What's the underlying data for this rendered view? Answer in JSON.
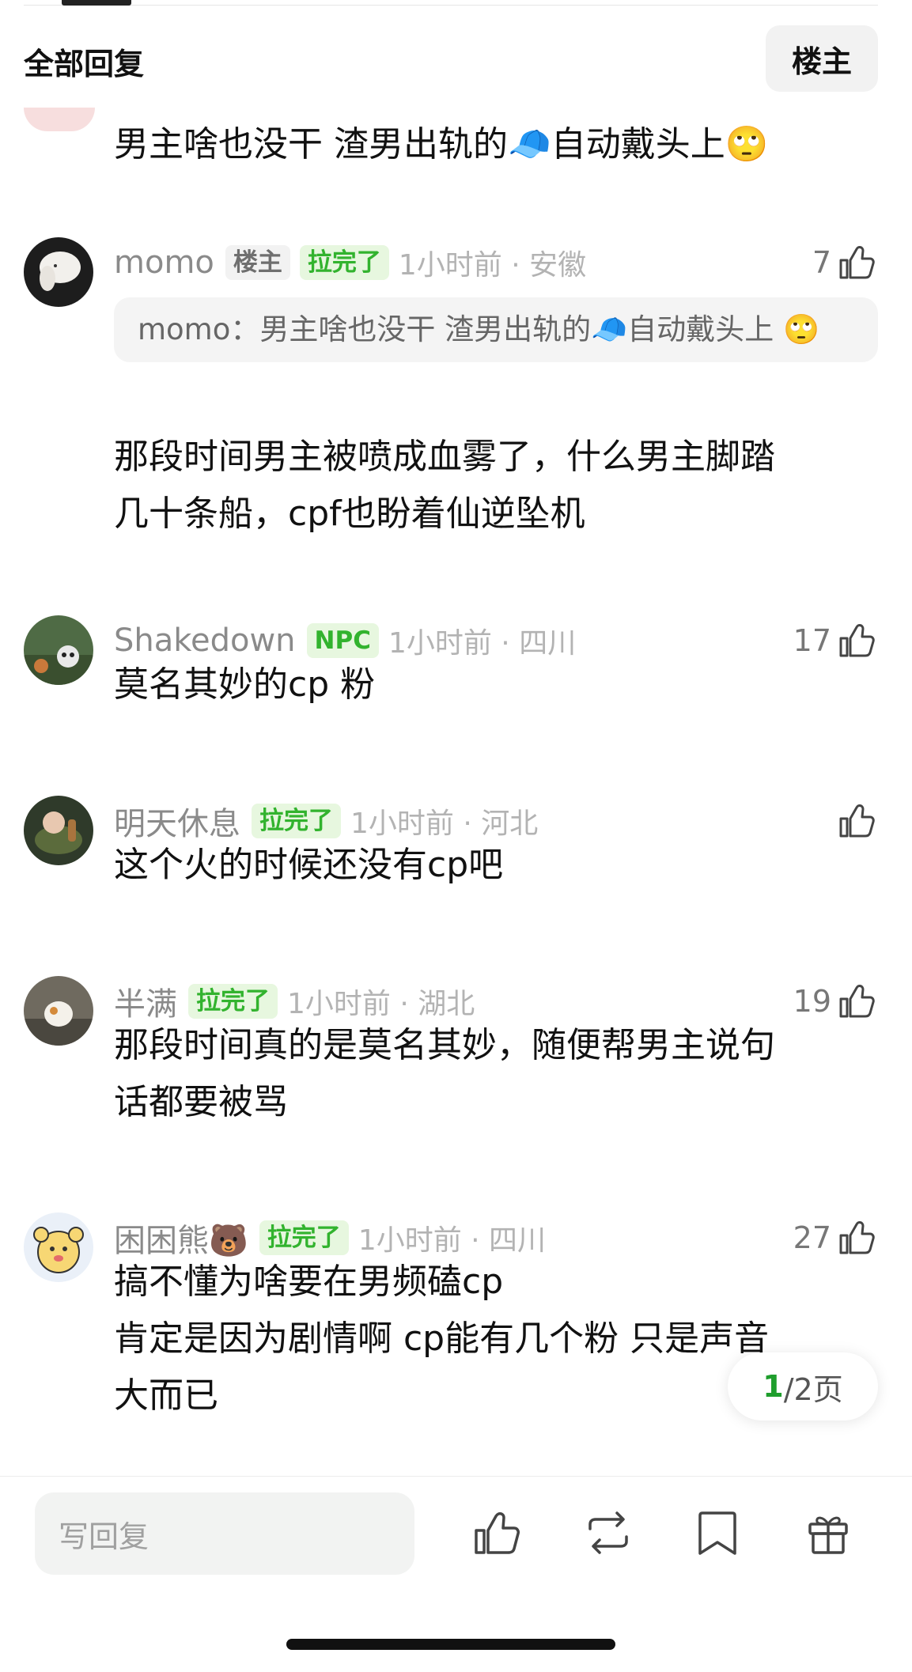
{
  "header": {
    "title": "全部回复",
    "op_button": "楼主"
  },
  "partial_comment": {
    "text": "男主啥也没干 渣男出轨的🧢自动戴头上🙄"
  },
  "comments": [
    {
      "username": "momo",
      "tags": [
        {
          "label": "楼主",
          "style": "gray"
        },
        {
          "label": "拉完了",
          "style": "green"
        }
      ],
      "time_location": "1小时前 · 安徽",
      "likes": "7",
      "quote": {
        "author": "momo：",
        "text": "男主啥也没干 渣男出轨的🧢自动戴头上 🙄"
      },
      "lines": [
        "那段时间男主被喷成血雾了，什么男主脚踏",
        "几十条船，cpf也盼着仙逆坠机"
      ]
    },
    {
      "username": "Shakedown",
      "tags": [
        {
          "label": "NPC",
          "style": "green"
        }
      ],
      "time_location": "1小时前 · 四川",
      "likes": "17",
      "lines": [
        "莫名其妙的cp 粉"
      ]
    },
    {
      "username": "明天休息",
      "tags": [
        {
          "label": "拉完了",
          "style": "green"
        }
      ],
      "time_location": "1小时前 · 河北",
      "likes": "",
      "lines": [
        "这个火的时候还没有cp吧"
      ]
    },
    {
      "username": "半满",
      "tags": [
        {
          "label": "拉完了",
          "style": "green"
        }
      ],
      "time_location": "1小时前 · 湖北",
      "likes": "19",
      "lines": [
        "那段时间真的是莫名其妙，随便帮男主说句",
        "话都要被骂"
      ]
    },
    {
      "username": "困困熊🐻",
      "tags": [
        {
          "label": "拉完了",
          "style": "green"
        }
      ],
      "time_location": "1小时前 · 四川",
      "likes": "27",
      "lines": [
        "搞不懂为啥要在男频磕cp",
        "肯定是因为剧情啊 cp能有几个粉 只是声音",
        "大而已"
      ]
    }
  ],
  "pager": {
    "current": "1",
    "total": "/2页"
  },
  "bottom_bar": {
    "reply_placeholder": "写回复"
  },
  "colors": {
    "accent_green": "#32b32e",
    "pager_green": "#1f9e2d",
    "tag_gray_bg": "#f2f2f2",
    "tag_green_bg": "#e7f7df"
  },
  "icons": [
    "thumbs-up-icon",
    "repost-icon",
    "bookmark-icon",
    "gift-icon"
  ]
}
